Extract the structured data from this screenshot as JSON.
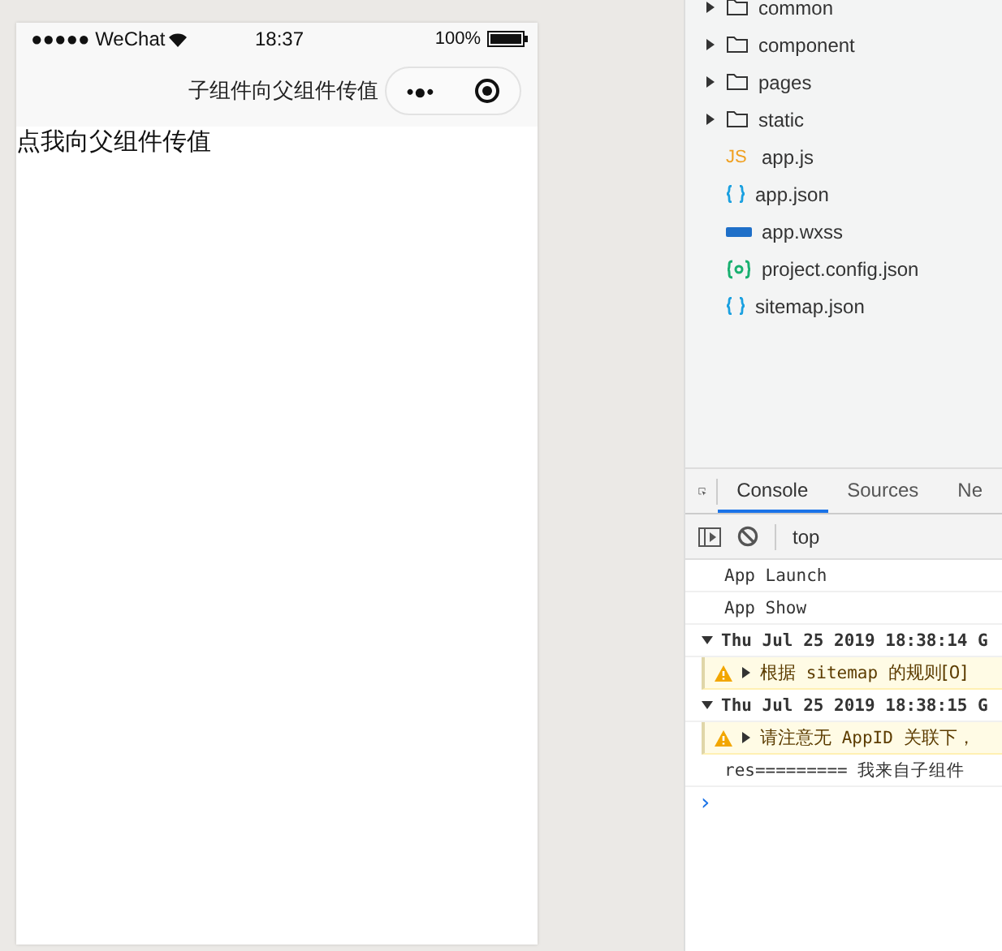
{
  "phone": {
    "status_bar": {
      "carrier": "●●●●● WeChat",
      "time": "18:37",
      "battery": "100%"
    },
    "nav": {
      "title": "子组件向父组件传值",
      "menu_button": "•●•"
    },
    "content": {
      "button": "点我向父组件传值"
    }
  },
  "file_tree": [
    {
      "name": "common",
      "kind": "folder",
      "expanded": false
    },
    {
      "name": "component",
      "kind": "folder",
      "expanded": false
    },
    {
      "name": "pages",
      "kind": "folder",
      "expanded": false
    },
    {
      "name": "static",
      "kind": "folder",
      "expanded": false
    },
    {
      "name": "app.js",
      "kind": "js",
      "icon_text": "JS"
    },
    {
      "name": "app.json",
      "kind": "json"
    },
    {
      "name": "app.wxss",
      "kind": "wxss"
    },
    {
      "name": "project.config.json",
      "kind": "config"
    },
    {
      "name": "sitemap.json",
      "kind": "json"
    }
  ],
  "devtools": {
    "tabs": [
      {
        "label": "Console",
        "selected": true
      },
      {
        "label": "Sources",
        "selected": false
      },
      {
        "label": "Ne",
        "selected": false
      }
    ],
    "context": "top",
    "console": [
      {
        "kind": "log",
        "text": "App Launch"
      },
      {
        "kind": "log",
        "text": "App Show"
      },
      {
        "kind": "group",
        "text": "Thu Jul 25 2019 18:38:14 G",
        "expanded": true
      },
      {
        "kind": "warning",
        "parts": [
          "根据",
          "sitemap",
          "的规则[0]"
        ]
      },
      {
        "kind": "group",
        "text": "Thu Jul 25 2019 18:38:15 G",
        "expanded": true
      },
      {
        "kind": "warning",
        "parts": [
          "请注意无",
          "AppID",
          "关联下，"
        ]
      },
      {
        "kind": "log",
        "text": "res========= 我来自子组件"
      },
      {
        "kind": "prompt",
        "text": "›"
      }
    ]
  }
}
